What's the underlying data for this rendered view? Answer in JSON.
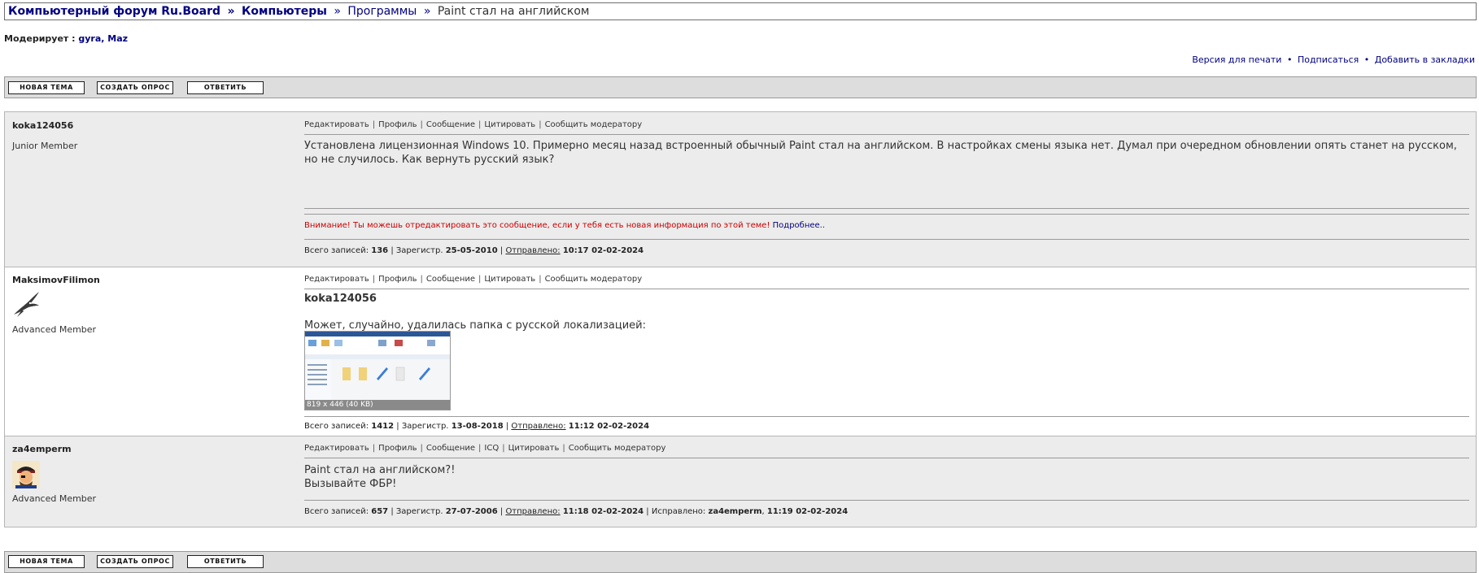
{
  "breadcrumb": {
    "forum": "Компьютерный форум Ru.Board",
    "sep": "»",
    "section": "Компьютеры",
    "subsection": "Программы",
    "topic": "Paint стал на английском"
  },
  "moderators": {
    "label": "Модерирует :",
    "names": "gyra, Maz"
  },
  "toplinks": {
    "print": "Версия для печати",
    "subscribe": "Подписаться",
    "bookmark": "Добавить в закладки",
    "dot": "•"
  },
  "buttons": {
    "new_topic": "НОВАЯ ТЕМА",
    "create_poll": "СОЗДАТЬ ОПРОС",
    "reply": "ОТВЕТИТЬ"
  },
  "actions": {
    "edit": "Редактировать",
    "profile": "Профиль",
    "message": "Сообщение",
    "icq": "ICQ",
    "quote": "Цитировать",
    "report": "Сообщить модератору",
    "pipe": "|"
  },
  "stats_labels": {
    "posts": "Всего записей:",
    "registered": "Зарегистр.",
    "sent": "Отправлено:",
    "edited": "Исправлено:"
  },
  "posts": [
    {
      "author": "koka124056",
      "rank": "Junior Member",
      "text": "Установлена лицензионная Windows 10. Примерно месяц назад встроенный обычный Paint стал на английском. В настройках смены языка нет. Думал при очередном обновлении опять станет на русском, но не случилось. Как вернуть русский язык?",
      "warning": "Внимание! Ты можешь отредактировать это сообщение, если у тебя есть новая информация по этой теме!",
      "warning_more": "Подробнее..",
      "post_count": "136",
      "registered": "25-05-2010",
      "sent": "10:17 02-02-2024"
    },
    {
      "author": "MaksimovFilimon",
      "rank": "Advanced Member",
      "quote_author": "koka124056",
      "text": "Может, случайно, удалилась папка с русской локализацией:",
      "image_caption": "819 x 446 (40 KB)",
      "post_count": "1412",
      "registered": "13-08-2018",
      "sent": "11:12 02-02-2024"
    },
    {
      "author": "za4emperm",
      "rank": "Advanced Member",
      "text_line1": "Paint стал на английском?!",
      "text_line2": "Вызывайте ФБР!",
      "post_count": "657",
      "registered": "27-07-2006",
      "sent": "11:18 02-02-2024",
      "edited_by": "za4emperm",
      "edited_at": "11:19 02-02-2024"
    }
  ],
  "colors": {
    "link_navy": "#000080",
    "warning_red": "#cc0000",
    "post_gray_bg": "#ececec",
    "button_bar_bg": "#dddddd"
  }
}
